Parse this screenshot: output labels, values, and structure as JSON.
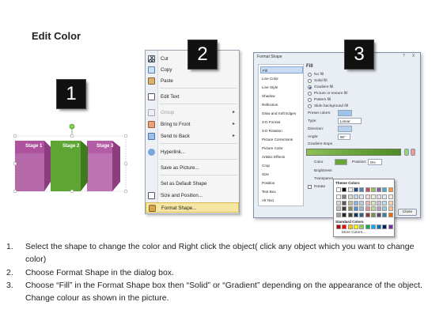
{
  "title": "Edit Color",
  "badges": [
    "1",
    "2",
    "3"
  ],
  "stages": [
    "Stage 1",
    "Stage 2",
    "Stage 3"
  ],
  "colors": {
    "magenta": "#a94f99",
    "green": "#5fa534",
    "badge": "#111111",
    "highlight": "#f6e6a3"
  },
  "context_menu": {
    "items": [
      {
        "label": "Cut",
        "icon": "scissors-icon",
        "disabled": false,
        "submenu": false
      },
      {
        "label": "Copy",
        "icon": "copy-icon",
        "disabled": false,
        "submenu": false
      },
      {
        "label": "Paste",
        "icon": "paste-icon",
        "disabled": false,
        "submenu": false
      },
      {
        "label": "Edit Text",
        "icon": "edit-text-icon",
        "disabled": false,
        "submenu": false
      },
      {
        "label": "Group",
        "icon": "group-icon",
        "disabled": true,
        "submenu": true
      },
      {
        "label": "Bring to Front",
        "icon": "bring-to-front-icon",
        "disabled": false,
        "submenu": true
      },
      {
        "label": "Send to Back",
        "icon": "send-to-back-icon",
        "disabled": false,
        "submenu": true
      },
      {
        "label": "Hyperlink...",
        "icon": "hyperlink-icon",
        "disabled": false,
        "submenu": false
      },
      {
        "label": "Save as Picture...",
        "icon": "",
        "disabled": false,
        "submenu": false
      },
      {
        "label": "Set as Default Shape",
        "icon": "",
        "disabled": false,
        "submenu": false
      },
      {
        "label": "Size and Position...",
        "icon": "size-position-icon",
        "disabled": false,
        "submenu": false
      },
      {
        "label": "Format Shape...",
        "icon": "format-shape-icon",
        "disabled": false,
        "submenu": false,
        "highlighted": true
      }
    ]
  },
  "dialog": {
    "title": "Format Shape",
    "controls": [
      "?",
      "X"
    ],
    "categories": [
      "Fill",
      "Line Color",
      "Line Style",
      "Shadow",
      "Reflection",
      "Glow and Soft Edges",
      "3-D Format",
      "3-D Rotation",
      "Picture Corrections",
      "Picture Color",
      "Artistic Effects",
      "Crop",
      "Size",
      "Position",
      "Text Box",
      "Alt Text"
    ],
    "selected_category": "Fill",
    "fill_heading": "Fill",
    "fill_options": [
      "No fill",
      "Solid fill",
      "Gradient fill",
      "Picture or texture fill",
      "Pattern fill",
      "Slide background fill"
    ],
    "selected_fill": "Gradient fill",
    "preset_colors_label": "Preset colors:",
    "type_label": "Type:",
    "type_value": "Linear",
    "direction_label": "Direction:",
    "angle_label": "Angle:",
    "angle_value": "90°",
    "gradient_stops_label": "Gradient stops",
    "color_label": "Color",
    "position_label": "Position:",
    "position_value": "0%",
    "brightness_label": "Brightness",
    "transparency_label": "Transparen",
    "rotate_label": "Rotate",
    "close_label": "Close"
  },
  "palette": {
    "theme_heading": "Theme Colors",
    "theme_colors": [
      [
        "#ffffff",
        "#000000",
        "#eeece1",
        "#1f497d",
        "#4f81bd",
        "#c0504d",
        "#9bbb59",
        "#8064a2",
        "#4bacc6",
        "#f79646"
      ],
      [
        "#f2f2f2",
        "#7f7f7f",
        "#ddd9c3",
        "#c6d9f0",
        "#dbe5f1",
        "#f2dcdb",
        "#ebf1dd",
        "#e5e0ec",
        "#dbeef3",
        "#fdeada"
      ],
      [
        "#d8d8d8",
        "#595959",
        "#c4bd97",
        "#8db3e2",
        "#b8cce4",
        "#e5b9b7",
        "#d7e3bc",
        "#ccc1d9",
        "#b7dde8",
        "#fbd5b5"
      ],
      [
        "#bfbfbf",
        "#3f3f3f",
        "#938953",
        "#548dd4",
        "#95b3d7",
        "#d99694",
        "#c3d69b",
        "#b2a2c7",
        "#92cddc",
        "#fac08f"
      ],
      [
        "#a5a5a5",
        "#262626",
        "#494429",
        "#17365d",
        "#366092",
        "#953734",
        "#76923c",
        "#5f497a",
        "#31859b",
        "#e36c09"
      ]
    ],
    "standard_heading": "Standard Colors",
    "standard_colors": [
      "#c00000",
      "#ff0000",
      "#ffc000",
      "#ffff00",
      "#92d050",
      "#00b050",
      "#00b0f0",
      "#0070c0",
      "#002060",
      "#7030a0"
    ],
    "more_colors": "More Colors..."
  },
  "instructions": [
    {
      "num": "1.",
      "text": "Select the shape to change the color and Right click the object( click any object which you want to change color)"
    },
    {
      "num": "2.",
      "text": "Choose Format Shape in the dialog box."
    },
    {
      "num": "3.",
      "text": "Choose “Fill” in the Format Shape box then “Solid” or “Gradient” depending on the appearance of the object. Change colour as shown in the picture."
    }
  ]
}
